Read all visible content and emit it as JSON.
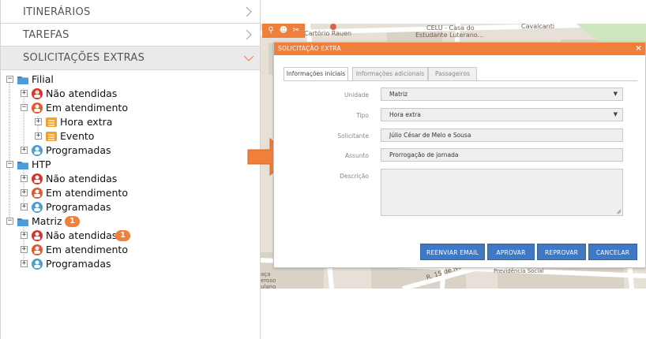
{
  "sidebar": {
    "sections": [
      {
        "label": "ITINERÁRIOS"
      },
      {
        "label": "TAREFAS"
      },
      {
        "label": "SOLICITAÇÕES EXTRAS"
      }
    ],
    "tree": [
      {
        "label": "Filial",
        "badge": ""
      },
      {
        "label": "Não atendidas",
        "badge": ""
      },
      {
        "label": "Em atendimento",
        "badge": ""
      },
      {
        "label": "Hora extra",
        "badge": ""
      },
      {
        "label": "Evento",
        "badge": ""
      },
      {
        "label": "Programadas",
        "badge": ""
      },
      {
        "label": "HTP",
        "badge": ""
      },
      {
        "label": "Não atendidas",
        "badge": ""
      },
      {
        "label": "Em atendimento",
        "badge": ""
      },
      {
        "label": "Programadas",
        "badge": ""
      },
      {
        "label": "Matriz",
        "badge": "1"
      },
      {
        "label": "Não atendidas",
        "badge": "1"
      },
      {
        "label": "Em atendimento",
        "badge": ""
      },
      {
        "label": "Programadas",
        "badge": ""
      }
    ]
  },
  "map": {
    "labels": [
      "Cartório Rauen",
      "CELU - Casa do",
      "Estudante Luterano...",
      "Cavalcanti",
      "R. 15 de Novem",
      "Previdência Social",
      "aça",
      "eroso",
      "ulano"
    ]
  },
  "modal": {
    "title": "SOLICITAÇÃO EXTRA",
    "close": "×",
    "tabs": [
      "Informações iniciais",
      "Informações adicionais",
      "Passageiros"
    ],
    "fields": {
      "unidade_label": "Unidade",
      "unidade_value": "Matriz",
      "tipo_label": "Tipo",
      "tipo_value": "Hora extra",
      "solicitante_label": "Solicitante",
      "solicitante_value": "Júlio César de Melo e Sousa",
      "assunto_label": "Assunto",
      "assunto_value": "Prorrogação de jornada",
      "descricao_label": "Descrição"
    },
    "buttons": {
      "reenviar": "REENVIAR EMAIL",
      "aprovar": "APROVAR",
      "reprovar": "REPROVAR",
      "cancelar": "CANCELAR"
    }
  },
  "colors": {
    "accent": "#f07f3c",
    "button": "#3f78c3"
  }
}
